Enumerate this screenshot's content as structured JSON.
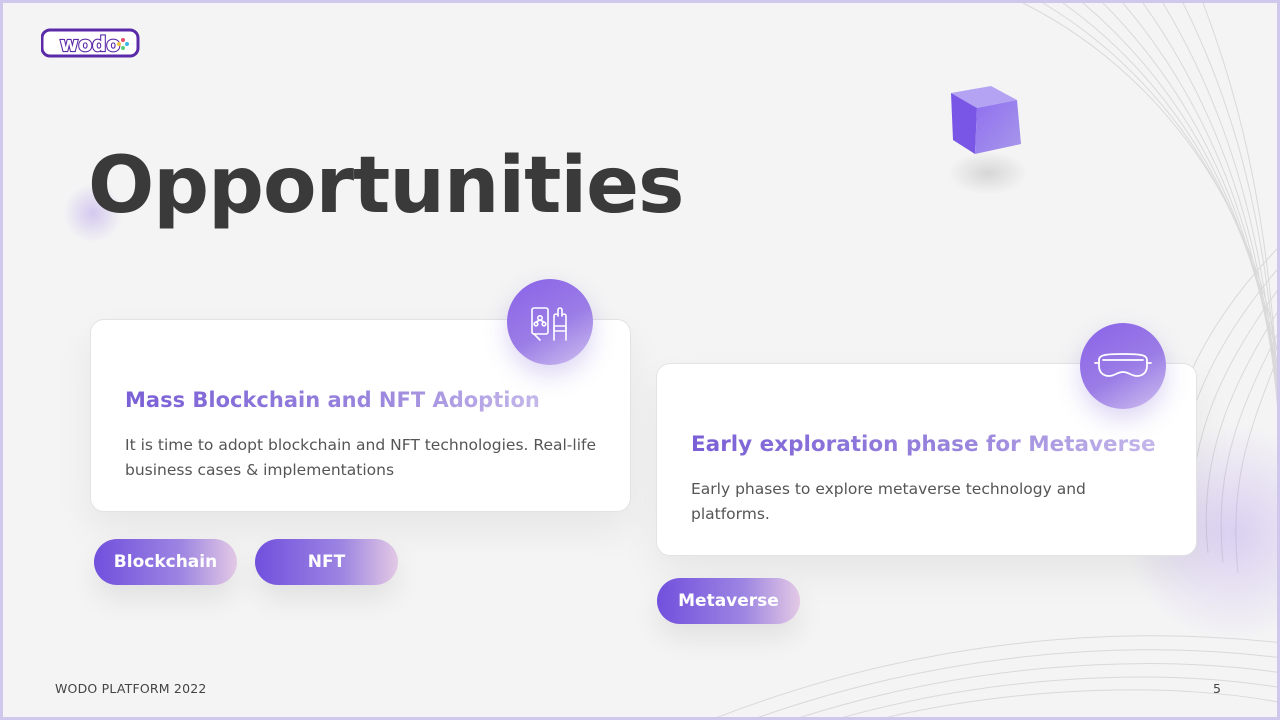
{
  "brand": {
    "logo_text": "wodo"
  },
  "slide": {
    "title": "Opportunities",
    "page_number": "5",
    "footer": "WODO PLATFORM 2022"
  },
  "cards": [
    {
      "heading": "Mass  Blockchain and NFT Adoption",
      "text": "It is time to adopt blockchain and NFT technologies. Real-life business cases & implementations",
      "icon": "blockchain-hands-icon"
    },
    {
      "heading": "Early exploration phase for Metaverse",
      "text": "Early phases to explore metaverse technology and platforms.",
      "icon": "vr-headset-icon"
    }
  ],
  "tags": {
    "blockchain": "Blockchain",
    "nft": "NFT",
    "metaverse": "Metaverse"
  },
  "colors": {
    "accent_start": "#7150dd",
    "accent_end": "#c5b8ea",
    "title": "#3a3a3a",
    "background": "#f4f4f4"
  }
}
